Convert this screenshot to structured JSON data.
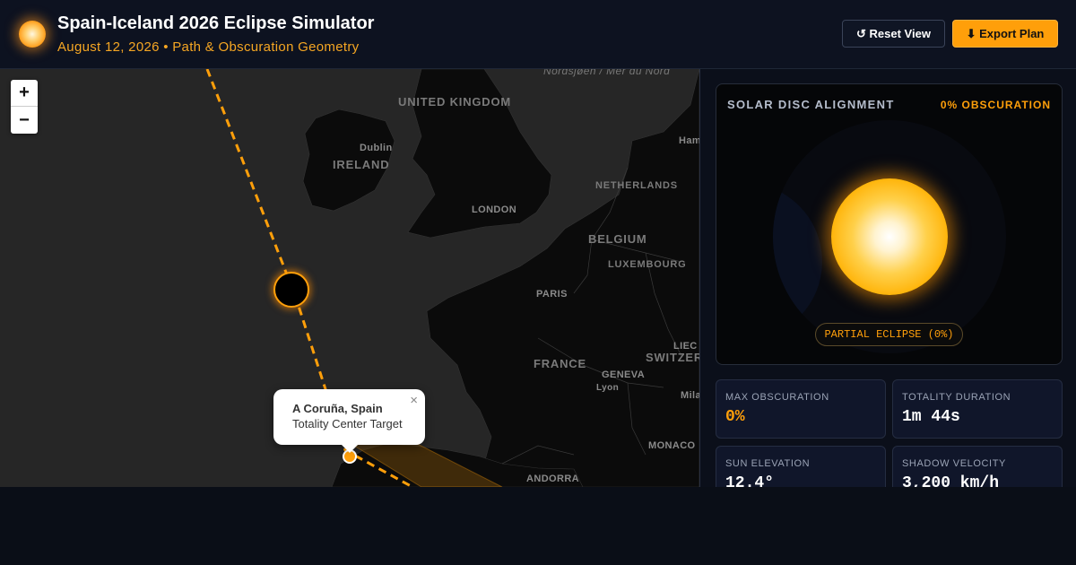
{
  "header": {
    "title": "Spain-Iceland 2026 Eclipse Simulator",
    "subtitle": "August 12, 2026 • Path & Obscuration Geometry",
    "reset_label": "↺ Reset View",
    "export_label": "⬇ Export Plan"
  },
  "map": {
    "zoom_in": "+",
    "zoom_out": "−",
    "labels": {
      "sea": "Nordsjøen / Mer du Nord",
      "uk": "UNITED KINGDOM",
      "dublin": "Dublin",
      "ireland": "IRELAND",
      "hamburg": "Ham",
      "netherlands": "NETHERLANDS",
      "london": "LONDON",
      "belgium": "BELGIUM",
      "luxembourg": "LUXEMBOURG",
      "paris": "PARIS",
      "liechtenstein": "LIEC",
      "switzerland": "SWITZER",
      "france": "FRANCE",
      "geneva": "GENEVA",
      "lyon": "Lyon",
      "milan": "Mila",
      "monaco": "MONACO",
      "andorra": "ANDORRA"
    },
    "popup": {
      "title": "A Coruña, Spain",
      "subtitle": "Totality Center Target",
      "close": "×"
    }
  },
  "alignment": {
    "title": "SOLAR DISC ALIGNMENT",
    "obscuration_badge": "0% OBSCURATION",
    "phase": "PARTIAL ECLIPSE (0%)"
  },
  "stats": [
    {
      "label": "MAX OBSCURATION",
      "value": "0%"
    },
    {
      "label": "TOTALITY DURATION",
      "value": "1m 44s"
    },
    {
      "label": "SUN ELEVATION",
      "value": "12.4°"
    },
    {
      "label": "SHADOW VELOCITY",
      "value": "3,200 km/h"
    }
  ],
  "colors": {
    "accent": "#ff9f0a",
    "background": "#0a0e17",
    "map_land": "#0b0b0b",
    "map_sea": "#262626"
  }
}
